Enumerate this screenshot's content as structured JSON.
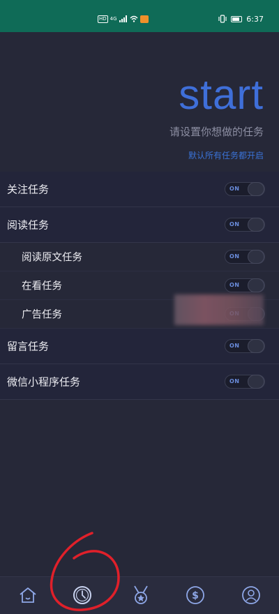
{
  "status_bar": {
    "time": "6:37",
    "network_badge": "4G"
  },
  "header": {
    "title": "start",
    "subtitle": "请设置你想做的任务",
    "default_note": "默认所有任务都开启"
  },
  "tasks": [
    {
      "label": "关注任务",
      "toggle": "ON",
      "sub": false
    },
    {
      "label": "阅读任务",
      "toggle": "ON",
      "sub": false
    },
    {
      "label": "阅读原文任务",
      "toggle": "ON",
      "sub": true
    },
    {
      "label": "在看任务",
      "toggle": "ON",
      "sub": true
    },
    {
      "label": "广告任务",
      "toggle": "ON",
      "sub": true
    },
    {
      "label": "留言任务",
      "toggle": "ON",
      "sub": false
    },
    {
      "label": "微信小程序任务",
      "toggle": "ON",
      "sub": false
    }
  ],
  "bottom_nav": [
    {
      "icon": "home-icon"
    },
    {
      "icon": "clock-icon"
    },
    {
      "icon": "medal-icon"
    },
    {
      "icon": "dollar-icon"
    },
    {
      "icon": "profile-icon"
    }
  ],
  "colors": {
    "status_bar": "#0f6b57",
    "background": "#262838",
    "accent": "#3f6fd9",
    "annotation": "#e0202a"
  }
}
